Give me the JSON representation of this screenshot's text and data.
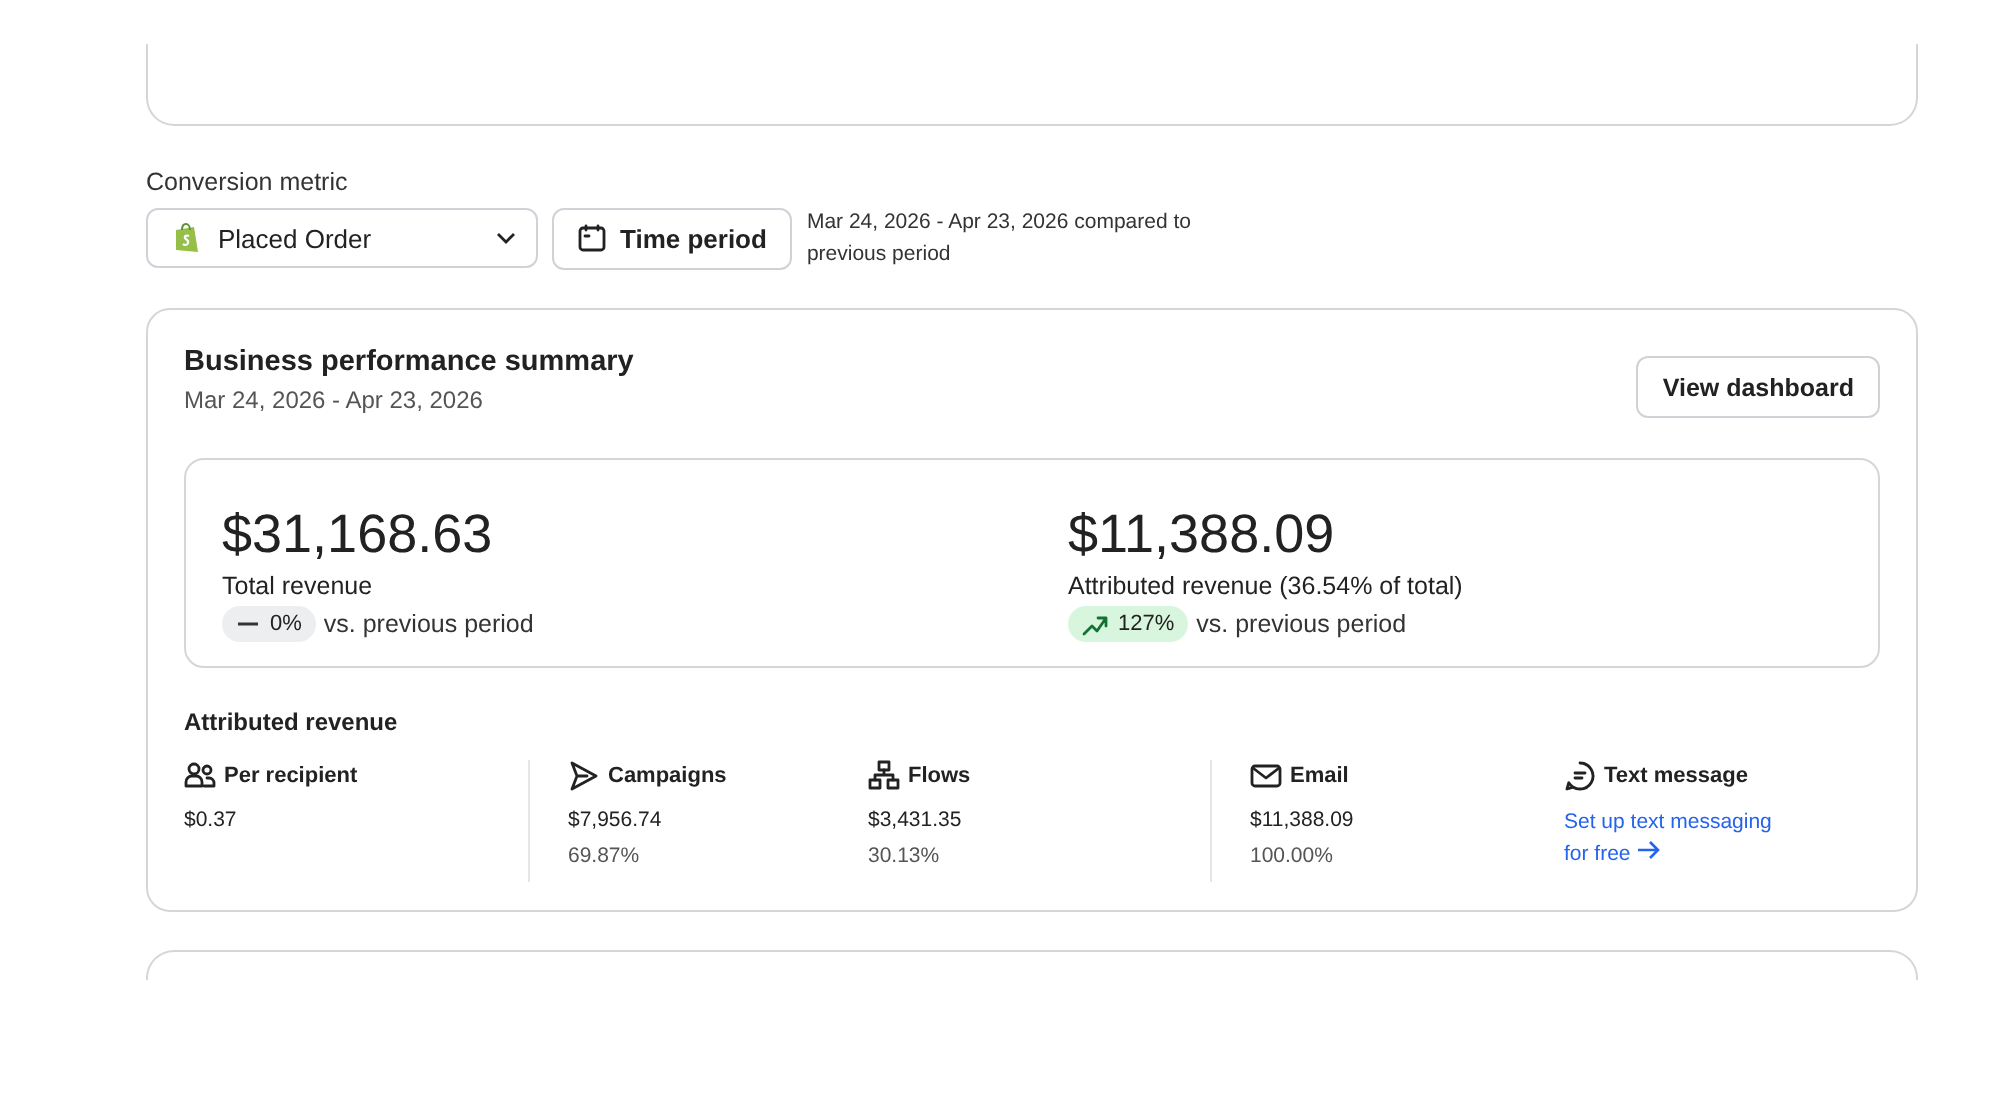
{
  "metric": {
    "label": "Conversion metric",
    "select": {
      "value": "Placed Order"
    },
    "time_button": "Time period",
    "period_note": "Mar 24, 2026 - Apr 23, 2026 compared to previous period"
  },
  "summary": {
    "title": "Business performance summary",
    "date_range": "Mar 24, 2026 - Apr 23, 2026",
    "button": "View dashboard",
    "kpis": [
      {
        "value": "$31,168.63",
        "label": "Total revenue",
        "delta": {
          "kind": "flat",
          "text": "0%"
        },
        "suffix": "vs. previous period"
      },
      {
        "value": "$11,388.09",
        "label": "Attributed revenue (36.54% of total)",
        "delta": {
          "kind": "up",
          "text": "127%"
        },
        "suffix": "vs. previous period"
      }
    ],
    "attributed": {
      "title": "Attributed revenue",
      "groups": [
        [
          {
            "kind": "value",
            "label": "Per recipient",
            "amount": "$0.37"
          }
        ],
        [
          {
            "kind": "value",
            "label": "Campaigns",
            "amount": "$7,956.74",
            "share": "69.87%"
          },
          {
            "kind": "value",
            "label": "Flows",
            "amount": "$3,431.35",
            "share": "30.13%"
          }
        ],
        [
          {
            "kind": "value",
            "label": "Email",
            "amount": "$11,388.09",
            "share": "100.00%"
          },
          {
            "kind": "link",
            "label": "Text message",
            "link": "Set up text messaging for free"
          }
        ]
      ]
    }
  }
}
